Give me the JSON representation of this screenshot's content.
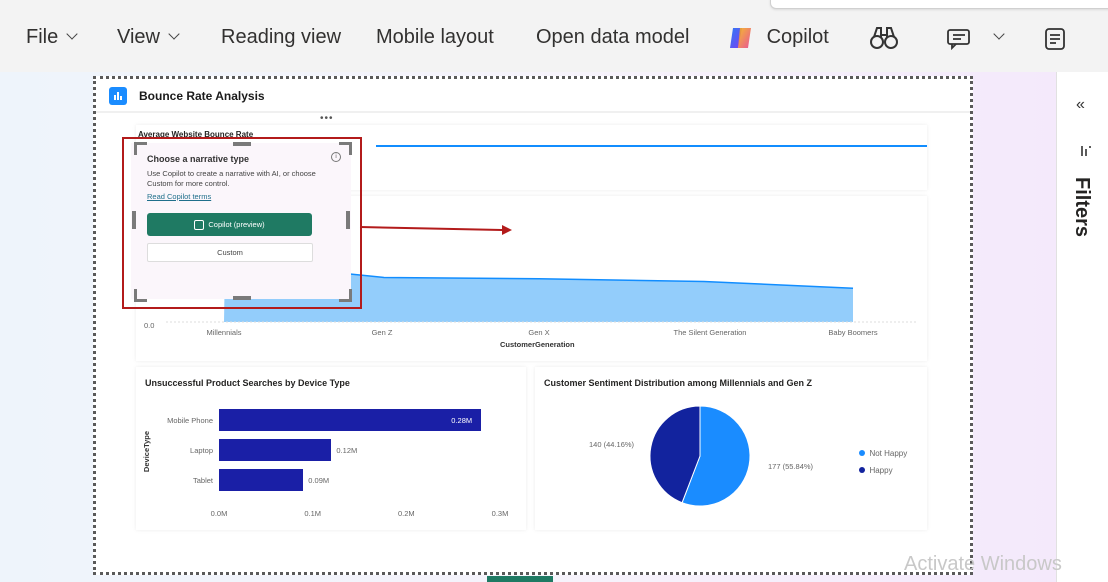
{
  "ribbon": {
    "file": "File",
    "view": "View",
    "reading_view": "Reading view",
    "mobile_layout": "Mobile layout",
    "open_data_model": "Open data model",
    "copilot": "Copilot"
  },
  "report": {
    "title": "Bounce Rate Analysis"
  },
  "visuals": {
    "top_card_title": "Average Website Bounce Rate",
    "area_chart": {
      "y_zero": "0.0",
      "categories": [
        "Millennials",
        "Gen Z",
        "Gen X",
        "The Silent Generation",
        "Baby Boomers"
      ],
      "xlabel": "CustomerGeneration"
    },
    "bar_chart": {
      "title": "Unsuccessful Product Searches by Device Type",
      "ylabel": "DeviceType",
      "categories": [
        "Mobile Phone",
        "Laptop",
        "Tablet"
      ],
      "value_labels": [
        "0.28M",
        "0.12M",
        "0.09M"
      ],
      "ticks": [
        "0.0M",
        "0.1M",
        "0.2M",
        "0.3M"
      ]
    },
    "pie_chart": {
      "title": "Customer Sentiment Distribution among Millennials and Gen Z",
      "label_left": "140 (44.16%)",
      "label_right": "177 (55.84%)",
      "legend": [
        "Not Happy",
        "Happy"
      ]
    }
  },
  "narrative_popup": {
    "title": "Choose a narrative type",
    "body": "Use Copilot to create a narrative with AI, or choose Custom for more control.",
    "link": "Read Copilot terms",
    "copilot_button": "Copilot (preview)",
    "custom_button": "Custom",
    "ellipsis": "•••"
  },
  "filters": {
    "label": "Filters"
  },
  "watermark": "Activate Windows",
  "colors": {
    "accent_green": "#1f7a63",
    "bar_navy": "#1a1fa6",
    "pie_light": "#1a8cff",
    "pie_dark": "#12239e",
    "area_fill": "#93cdfb",
    "line_blue": "#118dff",
    "highlight_red": "#b31b1b"
  },
  "chart_data": [
    {
      "type": "area",
      "categories": [
        "Millennials",
        "Gen Z",
        "Gen X",
        "The Silent Generation",
        "Baby Boomers"
      ],
      "xlabel": "CustomerGeneration",
      "note_values": "relative heights",
      "values": [
        0.45,
        0.33,
        0.32,
        0.3,
        0.25
      ]
    },
    {
      "type": "bar",
      "title": "Unsuccessful Product Searches by Device Type",
      "categories": [
        "Mobile Phone",
        "Laptop",
        "Tablet"
      ],
      "values": [
        0.28,
        0.12,
        0.09
      ],
      "unit": "M",
      "xlim": [
        0,
        0.3
      ],
      "ylabel": "DeviceType"
    },
    {
      "type": "pie",
      "title": "Customer Sentiment Distribution among Millennials and Gen Z",
      "labels": [
        "Not Happy",
        "Happy"
      ],
      "values": [
        177,
        140
      ],
      "percent": [
        55.84,
        44.16
      ]
    }
  ]
}
